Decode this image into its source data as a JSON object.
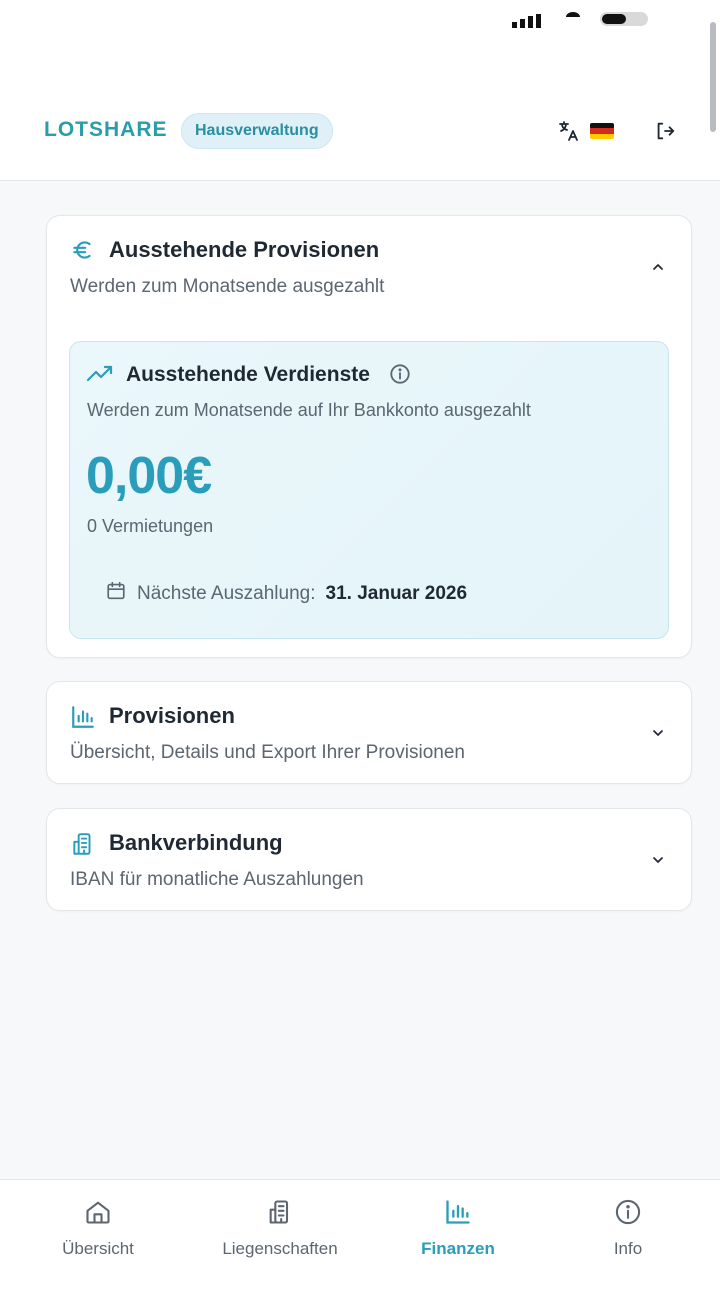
{
  "header": {
    "brand": "LOTSHARE",
    "badge": "Hausverwaltung"
  },
  "cards": {
    "pending": {
      "title": "Ausstehende Provisionen",
      "subtitle": "Werden zum Monatsende ausgezahlt",
      "expanded": true,
      "earnings": {
        "title": "Ausstehende Verdienste",
        "subtitle": "Werden zum Monatsende auf Ihr Bankkonto ausgezahlt",
        "amount": "0,00€",
        "rentals": "0 Vermietungen",
        "next_payout_label": "Nächste Auszahlung:",
        "next_payout_date": "31. Januar 2026"
      }
    },
    "commissions": {
      "title": "Provisionen",
      "subtitle": "Übersicht, Details und Export Ihrer Provisionen",
      "expanded": false
    },
    "bank": {
      "title": "Bankverbindung",
      "subtitle": "IBAN für monatliche Auszahlungen",
      "expanded": false
    }
  },
  "nav": {
    "items": [
      {
        "label": "Übersicht",
        "icon": "home-icon",
        "active": false
      },
      {
        "label": "Liegenschaften",
        "icon": "building-icon",
        "active": false
      },
      {
        "label": "Finanzen",
        "icon": "bar-chart-icon",
        "active": true
      },
      {
        "label": "Info",
        "icon": "info-icon",
        "active": false
      }
    ]
  },
  "colors": {
    "accent": "#2a9dba",
    "brand": "#2a9dab",
    "text": "#1f2933",
    "muted": "#5c6670"
  }
}
